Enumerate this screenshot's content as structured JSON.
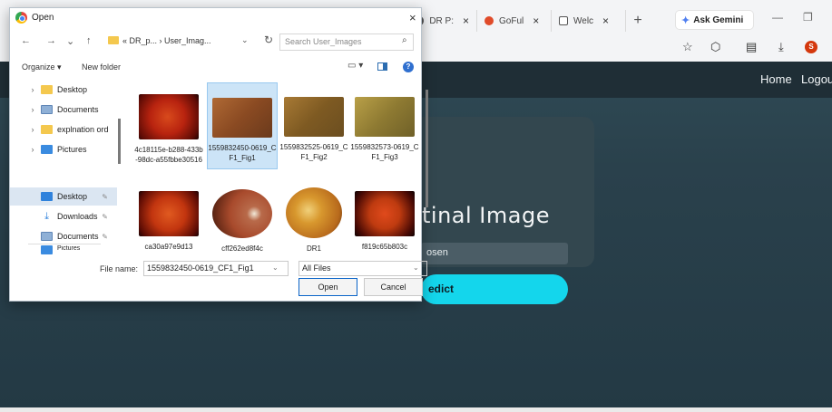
{
  "browser": {
    "tabs": [
      {
        "label": "DR P:",
        "close": "×"
      },
      {
        "label": "GoFul",
        "close": "×"
      },
      {
        "label": "Welc",
        "close": "×"
      }
    ],
    "new_tab": "+",
    "ask_gemini": "Ask Gemini",
    "profile_initial": "S"
  },
  "page": {
    "nav": {
      "home": "Home",
      "logout": "Logou"
    },
    "card_title": "tinal Image",
    "file_status": "osen",
    "predict_label": "edict"
  },
  "dialog": {
    "title": "Open",
    "close": "×",
    "breadcrumb": "« DR_p... › User_Imag...",
    "search_placeholder": "Search User_Images",
    "organize": "Organize ▾",
    "new_folder": "New folder",
    "nav_items": [
      {
        "label": "Desktop"
      },
      {
        "label": "Documents"
      },
      {
        "label": "explnation ord"
      },
      {
        "label": "Pictures"
      },
      {
        "label": "Desktop"
      },
      {
        "label": "Downloads"
      },
      {
        "label": "Documents"
      },
      {
        "label": "Pictures"
      }
    ],
    "files": [
      {
        "name": "4c18115e-b288-433b-98dc-a55fbbe30516",
        "thumb_color": "#b8230f"
      },
      {
        "name": "1559832450-0619_CF1_Fig1",
        "thumb_color": "#9c5a2a"
      },
      {
        "name": "1559832525-0619_CF1_Fig2",
        "thumb_color": "#8e6a2a"
      },
      {
        "name": "1559832573-0619_CF1_Fig3",
        "thumb_color": "#9a8a3a"
      },
      {
        "name": "ca30a97e9d13",
        "thumb_color": "#c2350f"
      },
      {
        "name": "cff262ed8f4c",
        "thumb_color": "#a84a2c"
      },
      {
        "name": "DR1",
        "thumb_color": "#c87f2a"
      },
      {
        "name": "f819c65b803c",
        "thumb_color": "#bf3b10"
      }
    ],
    "file_name_label": "File name:",
    "file_name_value": "1559832450-0619_CF1_Fig1",
    "file_type": "All Files",
    "open_label": "Open",
    "cancel_label": "Cancel"
  }
}
